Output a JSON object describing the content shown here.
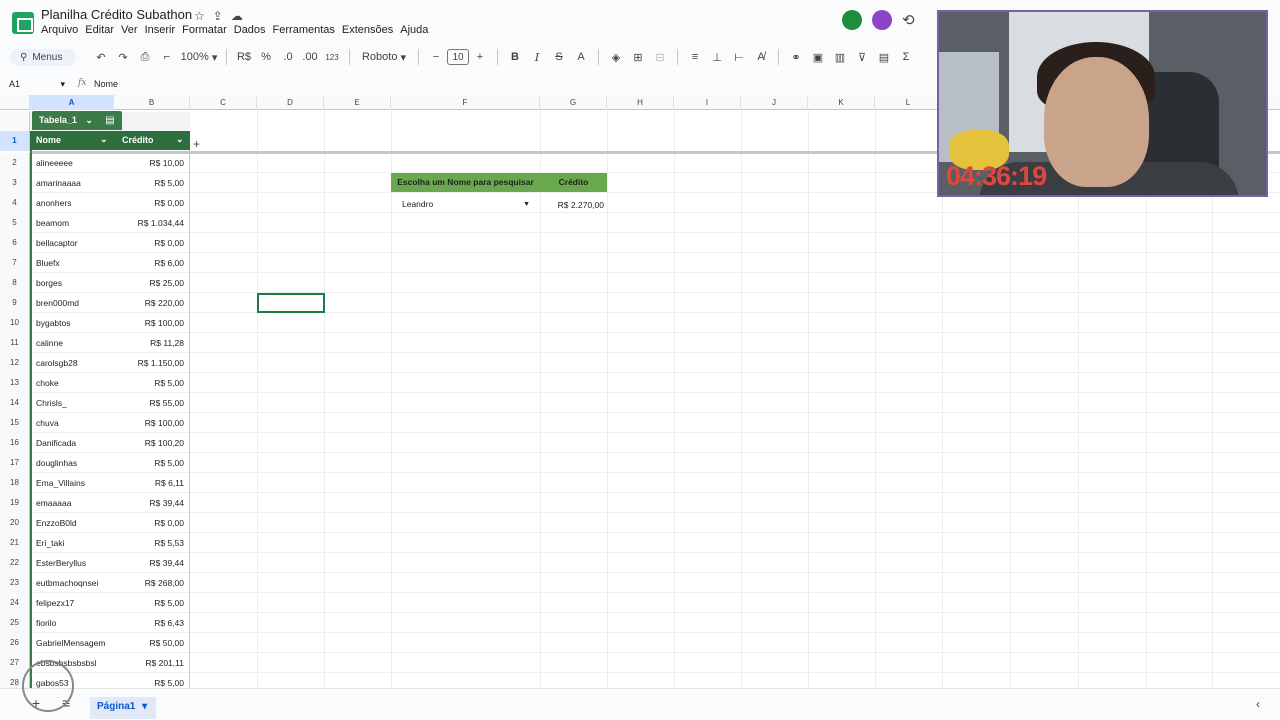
{
  "title_bar": {
    "doc_title": "Planilha Crédito Subathon",
    "menu": [
      "Arquivo",
      "Editar",
      "Ver",
      "Inserir",
      "Formatar",
      "Dados",
      "Ferramentas",
      "Extensões",
      "Ajuda"
    ]
  },
  "toolbar": {
    "menus_label": "Menus",
    "zoom": "100%",
    "currency": "R$",
    "percent": "%",
    "dec_less": ".0",
    "dec_more": ".00",
    "number_format": "123",
    "font_name": "Roboto",
    "font_size": "10",
    "bold": "B",
    "italic": "I",
    "strike": "S",
    "text_color": "A",
    "sum": "Σ"
  },
  "formula_bar": {
    "cell_ref": "A1",
    "fx": "fx",
    "value": "Nome"
  },
  "columns": [
    "A",
    "B",
    "C",
    "D",
    "E",
    "F",
    "G",
    "H",
    "I",
    "J",
    "K",
    "L"
  ],
  "table": {
    "tag": "Tabela_1",
    "header_name": "Nome",
    "header_credit": "Crédito",
    "rows": [
      {
        "num": "2",
        "name": "alineeeee",
        "credit": "R$ 10,00"
      },
      {
        "num": "3",
        "name": "amarinaaaa",
        "credit": "R$ 5,00"
      },
      {
        "num": "4",
        "name": "anonhers",
        "credit": "R$ 0,00"
      },
      {
        "num": "5",
        "name": "beamom",
        "credit": "R$ 1.034,44"
      },
      {
        "num": "6",
        "name": "bellacaptor",
        "credit": "R$ 0,00"
      },
      {
        "num": "7",
        "name": "Bluefx",
        "credit": "R$ 6,00"
      },
      {
        "num": "8",
        "name": "borges",
        "credit": "R$ 25,00"
      },
      {
        "num": "9",
        "name": "bren000md",
        "credit": "R$ 220,00"
      },
      {
        "num": "10",
        "name": "bygabtos",
        "credit": "R$ 100,00"
      },
      {
        "num": "11",
        "name": "calinne",
        "credit": "R$ 11,28"
      },
      {
        "num": "12",
        "name": "carolsgb28",
        "credit": "R$ 1.150,00"
      },
      {
        "num": "13",
        "name": "choke",
        "credit": "R$ 5,00"
      },
      {
        "num": "14",
        "name": "Chrisls_",
        "credit": "R$ 55,00"
      },
      {
        "num": "15",
        "name": "chuva",
        "credit": "R$ 100,00"
      },
      {
        "num": "16",
        "name": "Danificada",
        "credit": "R$ 100,20"
      },
      {
        "num": "17",
        "name": "douglinhas",
        "credit": "R$ 5,00"
      },
      {
        "num": "18",
        "name": "Ema_Villains",
        "credit": "R$ 6,11"
      },
      {
        "num": "19",
        "name": "emaaaaa",
        "credit": "R$ 39,44"
      },
      {
        "num": "20",
        "name": "EnzzoB0ld",
        "credit": "R$ 0,00"
      },
      {
        "num": "21",
        "name": "Eri_taki",
        "credit": "R$ 5,53"
      },
      {
        "num": "22",
        "name": "EsterBeryllus",
        "credit": "R$ 39,44"
      },
      {
        "num": "23",
        "name": "eutbmachoqnsei",
        "credit": "R$ 268,00"
      },
      {
        "num": "24",
        "name": "felipezx17",
        "credit": "R$ 5,00"
      },
      {
        "num": "25",
        "name": "fiorilo",
        "credit": "R$ 6,43"
      },
      {
        "num": "26",
        "name": "GabrielMensagem",
        "credit": "R$ 50,00"
      },
      {
        "num": "27",
        "name": "ebsbsbsbsbsbsl",
        "credit": "R$ 201,11"
      },
      {
        "num": "28",
        "name": "gabos53",
        "credit": "R$ 5,00"
      }
    ]
  },
  "search": {
    "label": "Escolha um Nome para pesquisar",
    "result_label": "Crédito",
    "selected": "Leandro",
    "result": "R$ 2.270,00"
  },
  "sheet_tab": "Página1",
  "webcam": {
    "timer": "04:36:19"
  },
  "colors": {
    "table_green": "#2e6e3c",
    "search_green": "#6aa84f",
    "selection_blue": "#d3e3fd",
    "timer_red": "#e0473c"
  }
}
